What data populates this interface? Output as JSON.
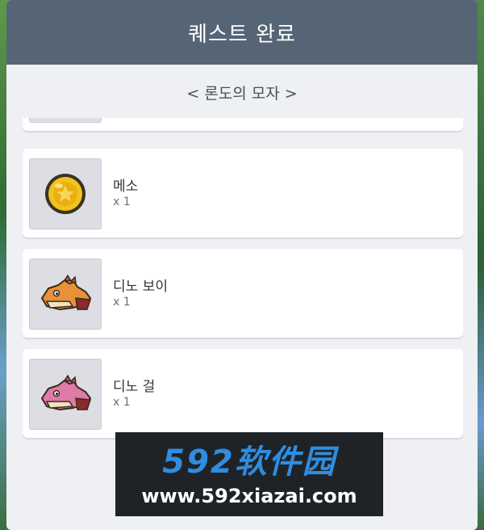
{
  "dialog": {
    "title": "퀘스트 완료",
    "quest_name": "< 론도의 모자 >"
  },
  "rewards": [
    {
      "name": "",
      "quantity": "",
      "icon": "partial-item-icon"
    },
    {
      "name": "메소",
      "quantity": "x 1",
      "icon": "meso-coin-icon"
    },
    {
      "name": "디노 보이",
      "quantity": "x 1",
      "icon": "dino-boy-icon"
    },
    {
      "name": "디노 걸",
      "quantity": "x 1",
      "icon": "dino-girl-icon"
    }
  ],
  "watermark": {
    "logo": "592软件园",
    "url": "www.592xiazai.com"
  },
  "colors": {
    "header": "#556576",
    "panel": "#eef0f3",
    "card": "#ffffff",
    "thumb": "#dcdee3",
    "dino_boy": "#e8913a",
    "dino_girl": "#e07aa8",
    "coin": "#f2c21e"
  }
}
